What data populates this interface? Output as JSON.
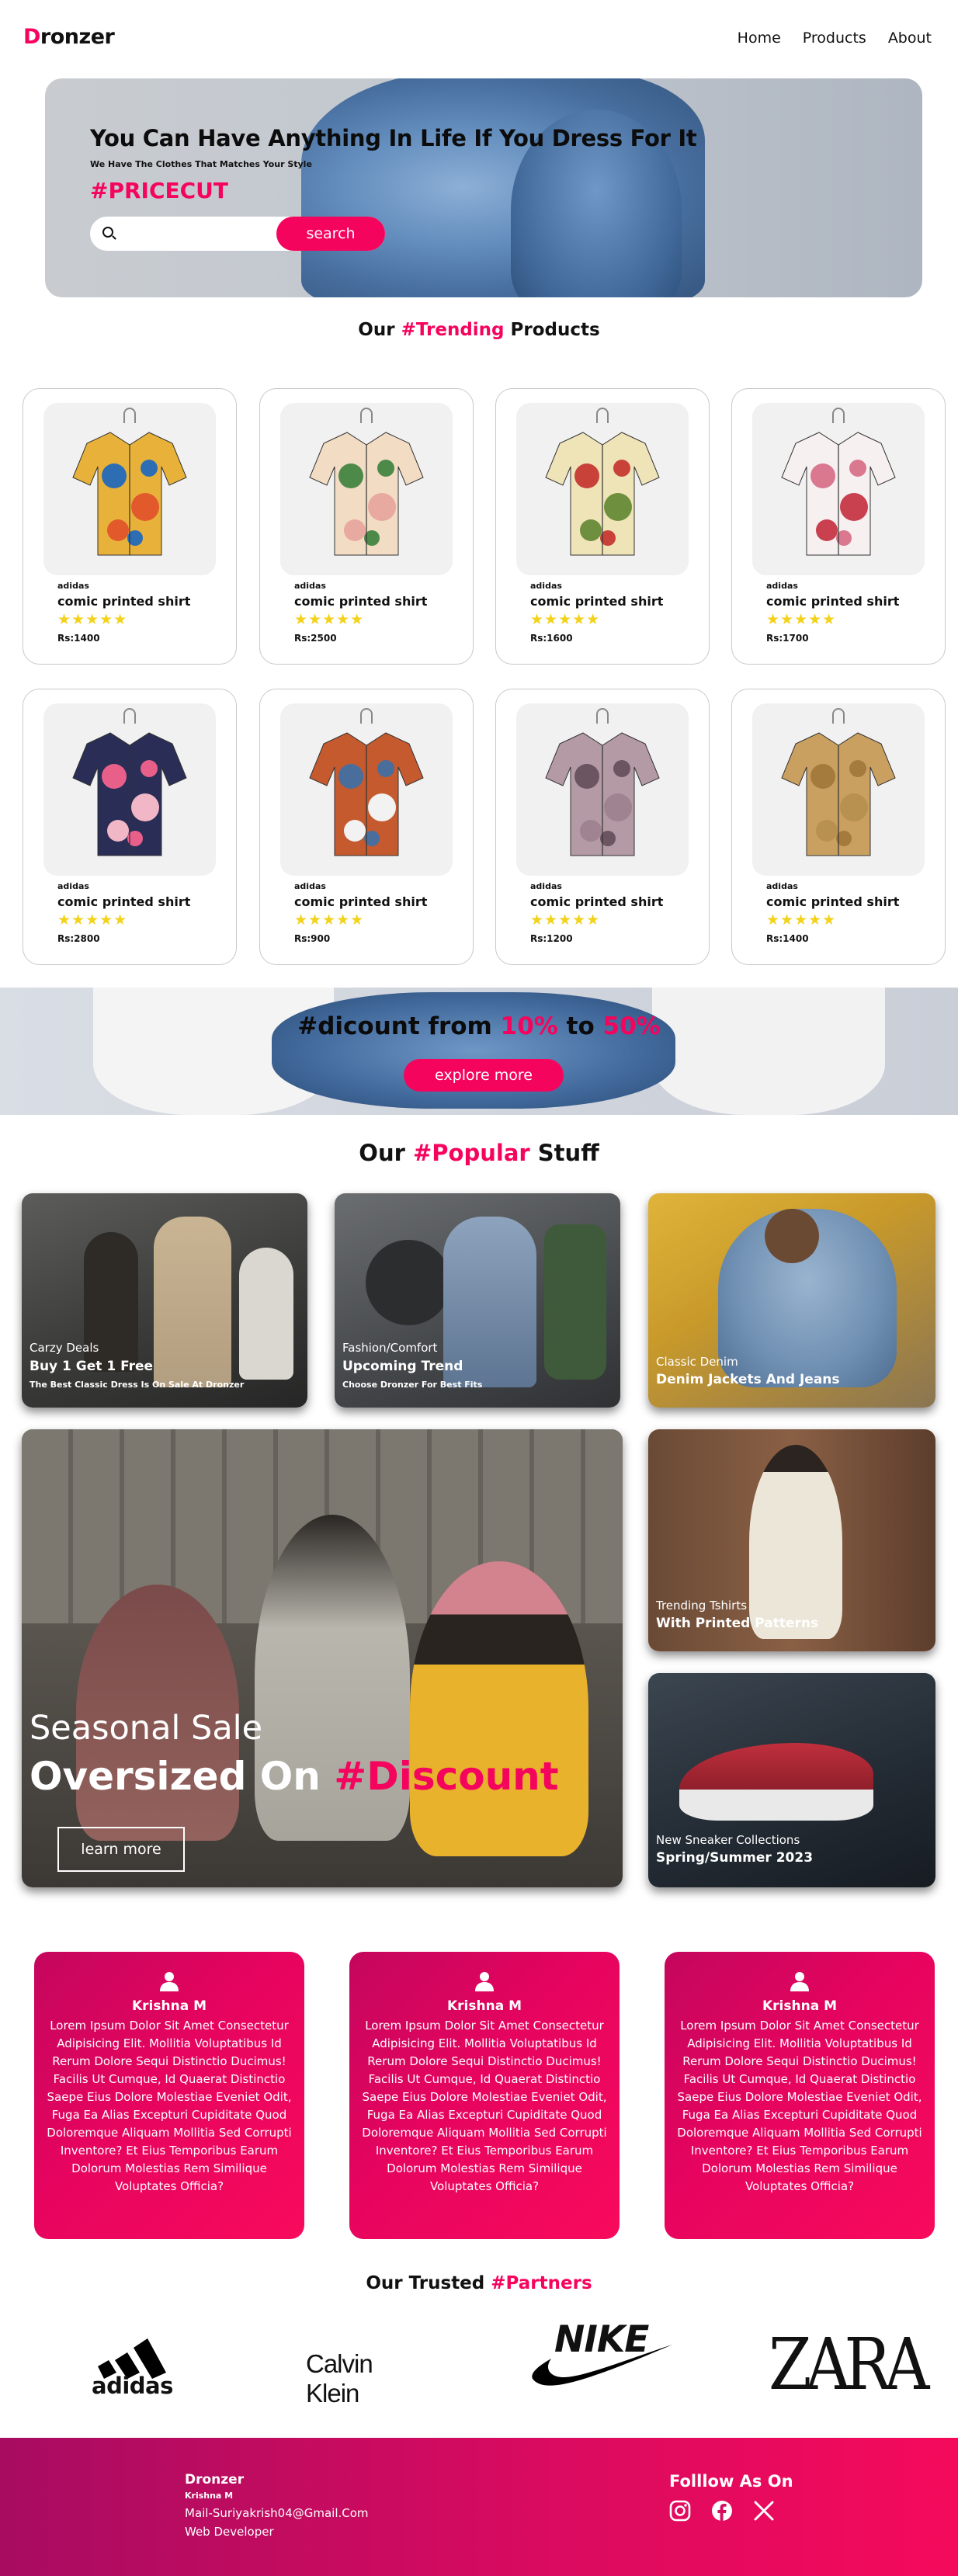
{
  "nav": {
    "logo_first": "D",
    "logo_rest": "ronzer",
    "links": [
      "Home",
      "Products",
      "About"
    ]
  },
  "hero": {
    "headline": "You Can Have Anything In Life If You Dress For It",
    "subline": "We Have The Clothes That Matches Your Style",
    "promo_code": "#PRICECUT",
    "search_placeholder": "",
    "search_button": "search"
  },
  "trending": {
    "prefix": "Our ",
    "highlight": "#Trending",
    "suffix": " Products"
  },
  "products": [
    {
      "brand": "adidas",
      "name": "comic printed shirt",
      "stars": "★★★★★",
      "price": "Rs:1400",
      "colors": [
        "#e8b23a",
        "#2d6db3",
        "#e25a2c"
      ]
    },
    {
      "brand": "adidas",
      "name": "comic printed shirt",
      "stars": "★★★★★",
      "price": "Rs:2500",
      "colors": [
        "#f2dcc4",
        "#4d8a4a",
        "#e8a9a0"
      ]
    },
    {
      "brand": "adidas",
      "name": "comic printed shirt",
      "stars": "★★★★★",
      "price": "Rs:1600",
      "colors": [
        "#efe3b8",
        "#c9423a",
        "#6e8f3e"
      ]
    },
    {
      "brand": "adidas",
      "name": "comic printed shirt",
      "stars": "★★★★★",
      "price": "Rs:1700",
      "colors": [
        "#f7f0f0",
        "#d9788f",
        "#c9404f"
      ]
    },
    {
      "brand": "adidas",
      "name": "comic printed shirt",
      "stars": "★★★★★",
      "price": "Rs:2800",
      "colors": [
        "#2a2d55",
        "#e8608a",
        "#f1b7c6"
      ]
    },
    {
      "brand": "adidas",
      "name": "comic printed shirt",
      "stars": "★★★★★",
      "price": "Rs:900",
      "colors": [
        "#c45a2e",
        "#4a6e9c",
        "#f2f2f2"
      ]
    },
    {
      "brand": "adidas",
      "name": "comic printed shirt",
      "stars": "★★★★★",
      "price": "Rs:1200",
      "colors": [
        "#b49aa5",
        "#6b5560",
        "#9f8391"
      ]
    },
    {
      "brand": "adidas",
      "name": "comic printed shirt",
      "stars": "★★★★★",
      "price": "Rs:1400",
      "colors": [
        "#c9a060",
        "#a57b3d",
        "#b8904f"
      ]
    }
  ],
  "banner": {
    "prefix": "#dicount from ",
    "low": "10%",
    "mid": " to ",
    "high": "50%",
    "button": "explore more"
  },
  "popular": {
    "prefix": "Our ",
    "highlight": "#Popular",
    "suffix": " Stuff"
  },
  "tiles": {
    "t1": {
      "category": "Carzy Deals",
      "title": "Buy 1 Get 1 Free",
      "desc": "The Best Classic Dress Is On Sale At Dronzer"
    },
    "t2": {
      "category": "Fashion/Comfort",
      "title": "Upcoming Trend",
      "desc": "Choose Dronzer For Best Fits"
    },
    "t3": {
      "category": "Classic Denim",
      "title": "Denim Jackets And Jeans"
    },
    "t4": {
      "category": "Trending Tshirts",
      "title": "With Printed Patterns"
    },
    "t5": {
      "category": "New Sneaker Collections",
      "title": "Spring/Summer 2023"
    },
    "big": {
      "line1": "Seasonal Sale",
      "line2_prefix": "Oversized On ",
      "line2_highlight": "#Discount",
      "button": "learn more"
    }
  },
  "testimonials": [
    {
      "name": "Krishna M",
      "text": "Lorem Ipsum Dolor Sit Amet Consectetur Adipisicing Elit. Mollitia Voluptatibus Id Rerum Dolore Sequi Distinctio Ducimus! Facilis Ut Cumque, Id Quaerat Distinctio Saepe Eius Dolore Molestiae Eveniet Odit, Fuga Ea Alias Excepturi Cupiditate Quod Doloremque Aliquam Mollitia Sed Corrupti Inventore? Et Eius Temporibus Earum Dolorum Molestias Rem Similique Voluptates Officia?"
    },
    {
      "name": "Krishna M",
      "text": "Lorem Ipsum Dolor Sit Amet Consectetur Adipisicing Elit. Mollitia Voluptatibus Id Rerum Dolore Sequi Distinctio Ducimus! Facilis Ut Cumque, Id Quaerat Distinctio Saepe Eius Dolore Molestiae Eveniet Odit, Fuga Ea Alias Excepturi Cupiditate Quod Doloremque Aliquam Mollitia Sed Corrupti Inventore? Et Eius Temporibus Earum Dolorum Molestias Rem Similique Voluptates Officia?"
    },
    {
      "name": "Krishna M",
      "text": "Lorem Ipsum Dolor Sit Amet Consectetur Adipisicing Elit. Mollitia Voluptatibus Id Rerum Dolore Sequi Distinctio Ducimus! Facilis Ut Cumque, Id Quaerat Distinctio Saepe Eius Dolore Molestiae Eveniet Odit, Fuga Ea Alias Excepturi Cupiditate Quod Doloremque Aliquam Mollitia Sed Corrupti Inventore? Et Eius Temporibus Earum Dolorum Molestias Rem Similique Voluptates Officia?"
    }
  ],
  "partners": {
    "prefix": "Our Trusted ",
    "highlight": "#Partners",
    "brands": [
      "adidas",
      "Calvin Klein",
      "NIKE",
      "ZARA"
    ]
  },
  "footer": {
    "brand": "Dronzer",
    "name": "Krishna M",
    "mail": "Mail-Suriyakrish04@Gmail.Com",
    "role": "Web Developer",
    "follow": "Folllow As On",
    "social": [
      "instagram-icon",
      "facebook-icon",
      "x-icon"
    ]
  },
  "colors": {
    "accent": "#f5045e",
    "star": "#f3d21b"
  }
}
